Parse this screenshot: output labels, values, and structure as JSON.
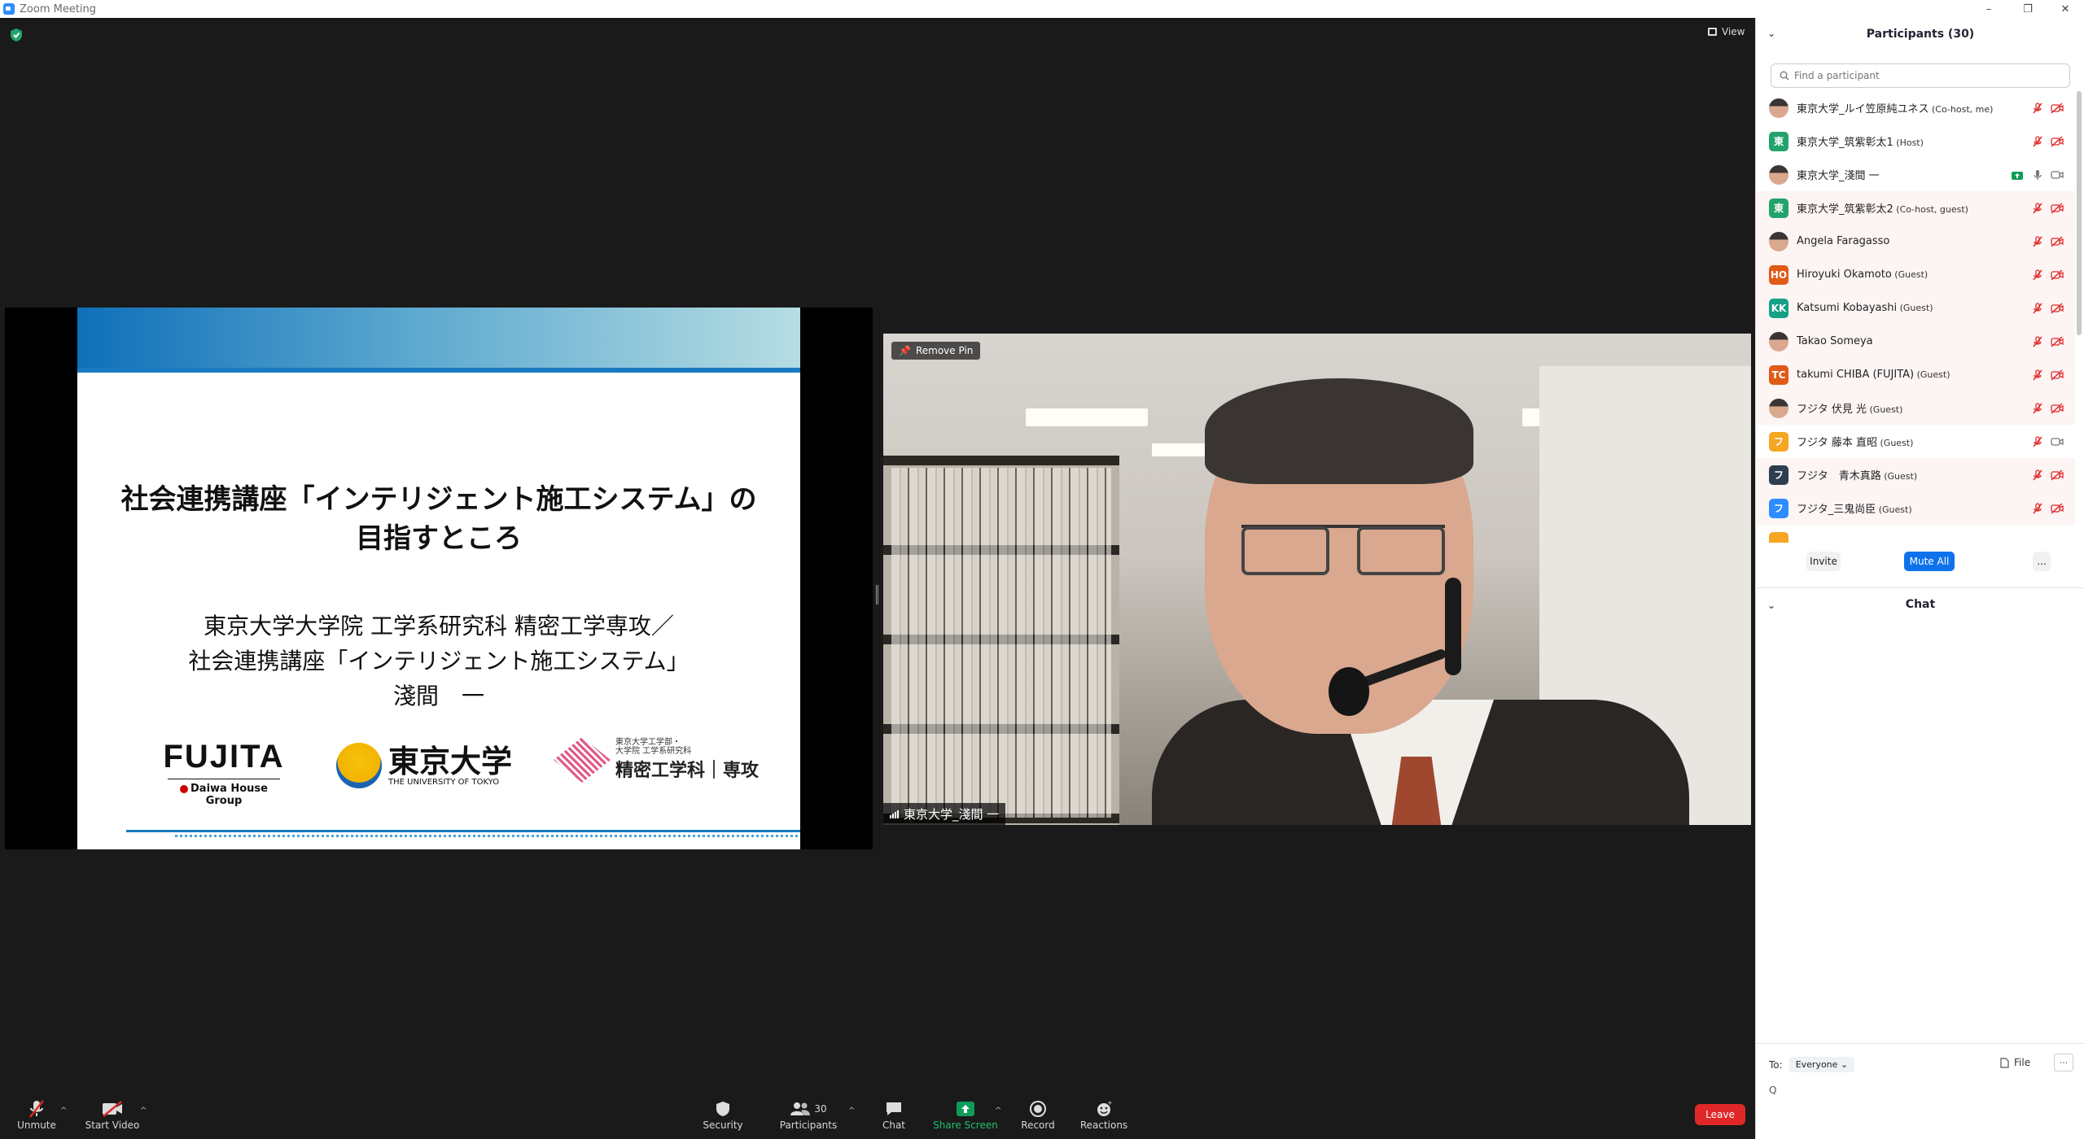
{
  "window": {
    "title": "Zoom Meeting",
    "controls": [
      "–",
      "❐",
      "✕"
    ]
  },
  "meeting": {
    "view_label": "View"
  },
  "slide": {
    "title_line1": "社会連携講座「インテリジェント施工システム」の",
    "title_line2": "目指すところ",
    "sub_line1": "東京大学大学院 工学系研究科 精密工学専攻／",
    "sub_line2": "社会連携講座「インテリジェント施工システム」",
    "sub_line3": "淺間　一",
    "logo_fujita": "FUJITA",
    "logo_daiwa": "Daiwa House Group",
    "logo_ut_jp": "東京大学",
    "logo_ut_en": "THE UNIVERSITY OF TOKYO",
    "logo_dept_small1": "東京大学工学部・",
    "logo_dept_small2": "大学院 工学系研究科",
    "logo_dept_big": "精密工学科｜専攻"
  },
  "video": {
    "remove_pin": "Remove Pin",
    "name": "東京大学_淺間 一"
  },
  "toolbar": {
    "unmute": "Unmute",
    "start_video": "Start Video",
    "security": "Security",
    "participants": "Participants",
    "participants_count": "30",
    "chat": "Chat",
    "share_screen": "Share Screen",
    "record": "Record",
    "reactions": "Reactions",
    "leave": "Leave"
  },
  "panel": {
    "title": "Participants (30)",
    "search_placeholder": "Find a participant",
    "participants": [
      {
        "name": "東京大学_ルイ笠原純ユネス",
        "role": " (Co-host, me)",
        "avatar": "photo",
        "color": "#555555",
        "mic": "off",
        "cam": "off"
      },
      {
        "name": "東京大学_筑紫彰太1",
        "role": " (Host)",
        "avatar": "東",
        "color": "#23a26d",
        "mic": "off",
        "cam": "off"
      },
      {
        "name": "東京大学_淺間 一",
        "role": "",
        "avatar": "photo",
        "color": "#555555",
        "mic": "on",
        "cam": "on"
      },
      {
        "name": "東京大学_筑紫彰太2",
        "role": " (Co-host, guest)",
        "avatar": "東",
        "color": "#23a26d",
        "mic": "off",
        "cam": "off"
      },
      {
        "name": "Angela Faragasso",
        "role": "",
        "avatar": "photo",
        "color": "#555555",
        "mic": "off",
        "cam": "off"
      },
      {
        "name": "Hiroyuki Okamoto",
        "role": " (Guest)",
        "avatar": "HO",
        "color": "#e05a18",
        "mic": "off",
        "cam": "off"
      },
      {
        "name": "Katsumi Kobayashi",
        "role": " (Guest)",
        "avatar": "KK",
        "color": "#16a085",
        "mic": "off",
        "cam": "off"
      },
      {
        "name": "Takao Someya",
        "role": "",
        "avatar": "photo",
        "color": "#555555",
        "mic": "off",
        "cam": "off"
      },
      {
        "name": "takumi CHIBA (FUJITA)",
        "role": " (Guest)",
        "avatar": "TC",
        "color": "#e05a18",
        "mic": "off",
        "cam": "off"
      },
      {
        "name": "フジタ 伏見 光",
        "role": " (Guest)",
        "avatar": "photo",
        "color": "#555555",
        "mic": "off",
        "cam": "off"
      },
      {
        "name": "フジタ 藤本 直昭",
        "role": " (Guest)",
        "avatar": "フ",
        "color": "#f5a623",
        "mic": "off",
        "cam": "on"
      },
      {
        "name": "フジタ　青木真路",
        "role": " (Guest)",
        "avatar": "フ",
        "color": "#2c3e50",
        "mic": "off",
        "cam": "off"
      },
      {
        "name": "フジタ_三鬼尚臣",
        "role": " (Guest)",
        "avatar": "フ",
        "color": "#2d8cff",
        "mic": "off",
        "cam": "off"
      }
    ],
    "invite": "Invite",
    "mute_all": "Mute All",
    "more": "...",
    "chat_title": "Chat",
    "to_label": "To:",
    "to_value": "Everyone",
    "file_label": "File",
    "more_btn": "···",
    "chat_placeholder": "Q"
  },
  "colors": {
    "accent": "#2d8cff",
    "leave": "#e02828",
    "share": "#0e9d59",
    "mic_off": "#e02828"
  }
}
